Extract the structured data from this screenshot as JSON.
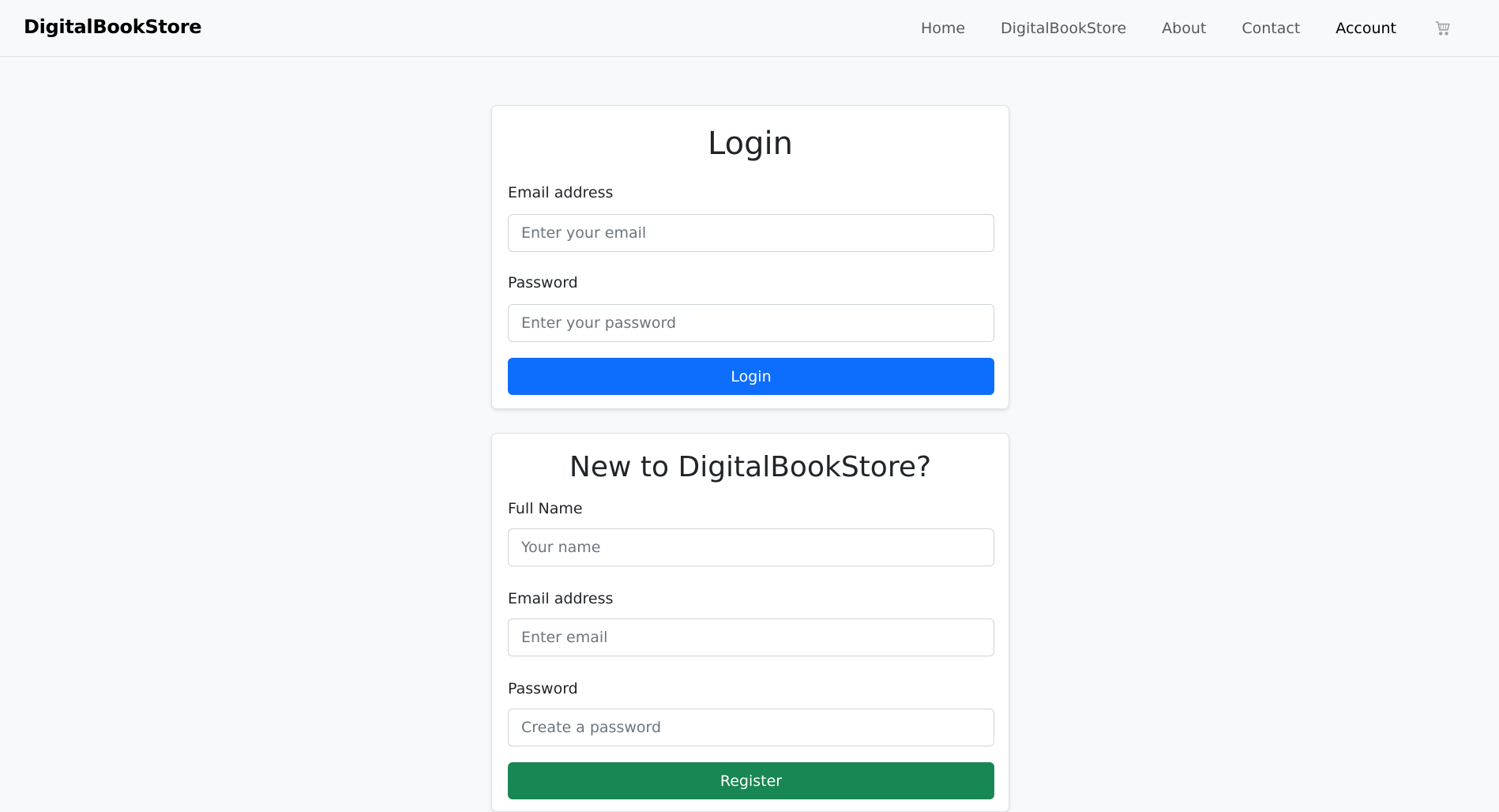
{
  "navbar": {
    "brand": "DigitalBookStore",
    "links": [
      "Home",
      "DigitalBookStore",
      "About",
      "Contact",
      "Account"
    ],
    "active_link": "Account",
    "cart_icon": "shopping-cart-icon"
  },
  "login": {
    "title": "Login",
    "email_label": "Email address",
    "email_placeholder": "Enter your email",
    "password_label": "Password",
    "password_placeholder": "Enter your password",
    "button_label": "Login",
    "button_color": "#0d6efd"
  },
  "register": {
    "title": "New to DigitalBookStore?",
    "name_label": "Full Name",
    "name_placeholder": "Your name",
    "email_label": "Email address",
    "email_placeholder": "Enter email",
    "password_label": "Password",
    "password_placeholder": "Create a password",
    "button_label": "Register",
    "button_color": "#198754"
  }
}
